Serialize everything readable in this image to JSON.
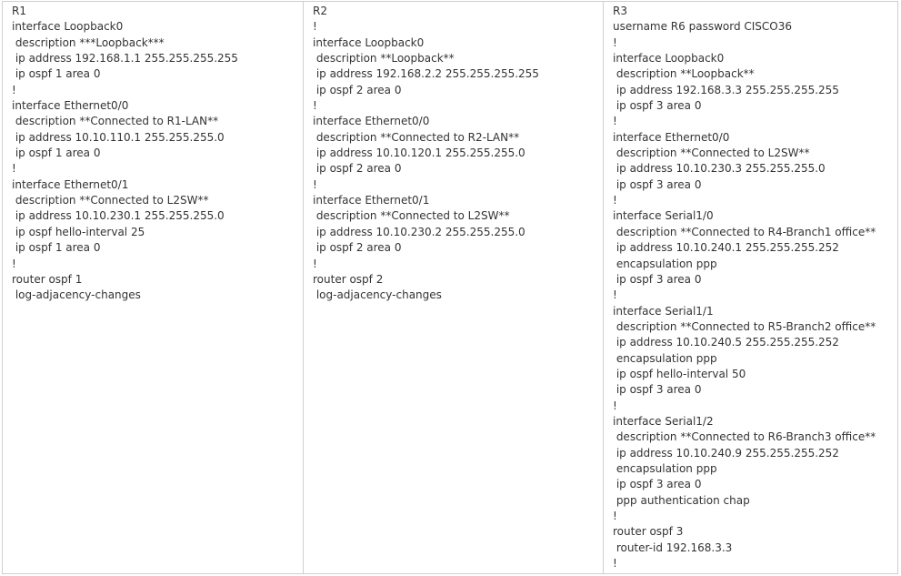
{
  "columns": [
    {
      "router": "R1",
      "lines": [
        "R1",
        "interface Loopback0",
        " description ***Loopback***",
        " ip address 192.168.1.1 255.255.255.255",
        " ip ospf 1 area 0",
        "!",
        "interface Ethernet0/0",
        " description **Connected to R1-LAN**",
        " ip address 10.10.110.1 255.255.255.0",
        " ip ospf 1 area 0",
        "!",
        "interface Ethernet0/1",
        " description **Connected to L2SW**",
        " ip address 10.10.230.1 255.255.255.0",
        " ip ospf hello-interval 25",
        " ip ospf 1 area 0",
        "!",
        "router ospf 1",
        " log-adjacency-changes"
      ]
    },
    {
      "router": "R2",
      "lines": [
        "R2",
        "!",
        "interface Loopback0",
        " description **Loopback**",
        " ip address 192.168.2.2 255.255.255.255",
        " ip ospf 2 area 0",
        "!",
        "interface Ethernet0/0",
        " description **Connected to R2-LAN**",
        " ip address 10.10.120.1 255.255.255.0",
        " ip ospf 2 area 0",
        "!",
        "interface Ethernet0/1",
        " description **Connected to L2SW**",
        " ip address 10.10.230.2 255.255.255.0",
        " ip ospf 2 area 0",
        "!",
        "router ospf 2",
        " log-adjacency-changes"
      ]
    },
    {
      "router": "R3",
      "lines": [
        "R3",
        "username R6 password CISCO36",
        "!",
        "interface Loopback0",
        " description **Loopback**",
        " ip address 192.168.3.3 255.255.255.255",
        " ip ospf 3 area 0",
        "!",
        "interface Ethernet0/0",
        " description **Connected to L2SW**",
        " ip address 10.10.230.3 255.255.255.0",
        " ip ospf 3 area 0",
        "!",
        "interface Serial1/0",
        " description **Connected to R4-Branch1 office**",
        " ip address 10.10.240.1 255.255.255.252",
        " encapsulation ppp",
        " ip ospf 3 area 0",
        "!",
        "interface Serial1/1",
        " description **Connected to R5-Branch2 office**",
        " ip address 10.10.240.5 255.255.255.252",
        " encapsulation ppp",
        " ip ospf hello-interval 50",
        " ip ospf 3 area 0",
        "!",
        "interface Serial1/2",
        " description **Connected to R6-Branch3 office**",
        " ip address 10.10.240.9 255.255.255.252",
        " encapsulation ppp",
        " ip ospf 3 area 0",
        " ppp authentication chap",
        "!",
        "router ospf 3",
        " router-id 192.168.3.3",
        "!"
      ]
    }
  ]
}
